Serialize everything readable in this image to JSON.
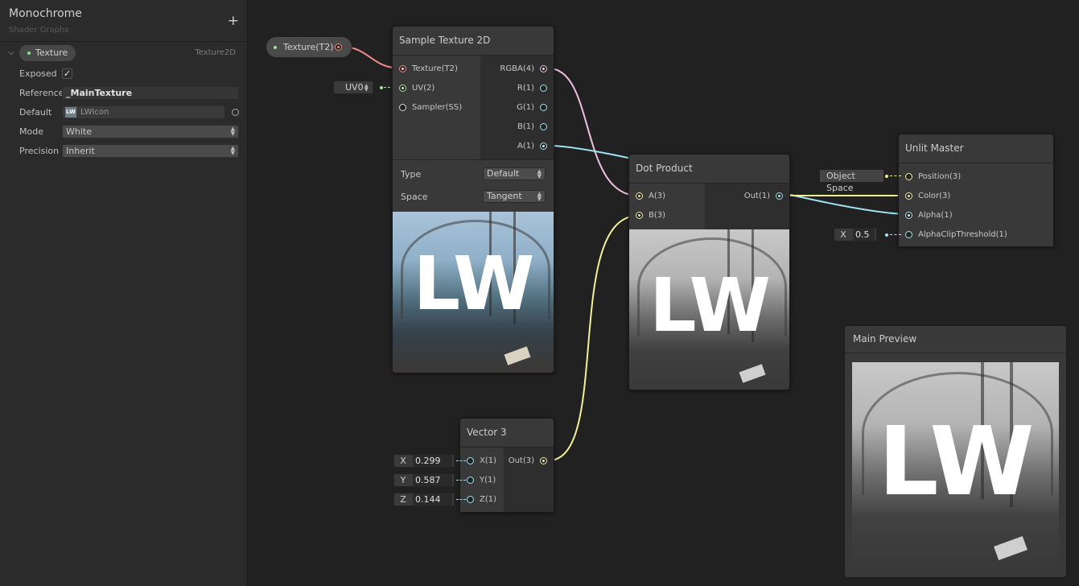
{
  "blackboard": {
    "title": "Monochrome",
    "subtitle": "Shader Graphs",
    "add_icon": "+",
    "property": {
      "name": "Texture",
      "type": "Texture2D",
      "exposed_label": "Exposed",
      "exposed_checked": true,
      "reference_label": "Reference",
      "reference_value": "_MainTexture",
      "default_label": "Default",
      "default_value": "LWIcon",
      "mode_label": "Mode",
      "mode_value": "White",
      "precision_label": "Precision",
      "precision_value": "Inherit"
    }
  },
  "graph": {
    "property_node": {
      "label": "Texture(T2)"
    },
    "uv_field": "UV0",
    "sample_texture": {
      "title": "Sample Texture 2D",
      "inputs": [
        "Texture(T2)",
        "UV(2)",
        "Sampler(SS)"
      ],
      "outputs": [
        "RGBA(4)",
        "R(1)",
        "G(1)",
        "B(1)",
        "A(1)"
      ],
      "type_label": "Type",
      "type_value": "Default",
      "space_label": "Space",
      "space_value": "Tangent",
      "preview_text": "LW"
    },
    "dot_product": {
      "title": "Dot Product",
      "inputs": [
        "A(3)",
        "B(3)"
      ],
      "outputs": [
        "Out(1)"
      ],
      "preview_text": "LW"
    },
    "vector3": {
      "title": "Vector 3",
      "inputs": [
        "X(1)",
        "Y(1)",
        "Z(1)"
      ],
      "outputs": [
        "Out(3)"
      ],
      "fields": [
        {
          "axis": "X",
          "value": "0.299"
        },
        {
          "axis": "Y",
          "value": "0.587"
        },
        {
          "axis": "Z",
          "value": "0.144"
        }
      ]
    },
    "unlit_master": {
      "title": "Unlit Master",
      "inputs": [
        "Position(3)",
        "Color(3)",
        "Alpha(1)",
        "AlphaClipThreshold(1)"
      ],
      "object_space": "Object Space",
      "alpha_clip": {
        "axis": "X",
        "value": "0.5"
      }
    },
    "main_preview": {
      "title": "Main Preview",
      "preview_text": "LW"
    }
  },
  "colors": {
    "texture_wire": "#f08a8a",
    "vector4_wire": "#f2bfe3",
    "vector3_wire": "#f3f09a",
    "vector1_wire": "#9fe4f0",
    "vector2_wire": "#a3e89a"
  }
}
